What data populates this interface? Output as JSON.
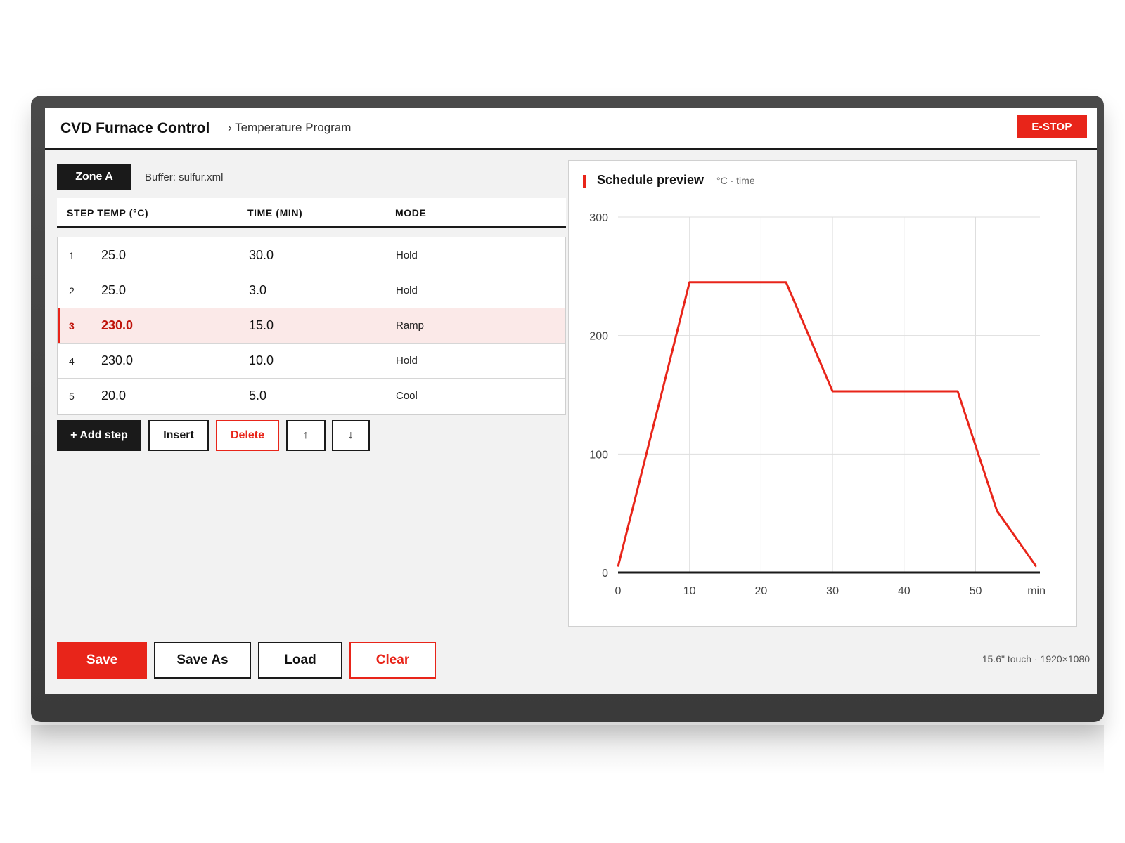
{
  "header": {
    "app_title": "CVD Furnace Control",
    "breadcrumb": "› Temperature Program",
    "estop_label": "E-STOP"
  },
  "program": {
    "zone_label": "Zone A",
    "buffer_label": "Buffer: sulfur.xml",
    "columns": [
      "STEP TEMP (°C)",
      "TIME (MIN)",
      "MODE"
    ],
    "rows": [
      {
        "index": "1",
        "temp": "25.0",
        "time": "30.0",
        "mode": "Hold"
      },
      {
        "index": "2",
        "temp": "25.0",
        "time": "3.0",
        "mode": "Hold"
      },
      {
        "index": "3",
        "temp": "230.0",
        "time": "15.0",
        "mode": "Ramp"
      },
      {
        "index": "4",
        "temp": "230.0",
        "time": "10.0",
        "mode": "Hold"
      },
      {
        "index": "5",
        "temp": "20.0",
        "time": "5.0",
        "mode": "Cool"
      }
    ],
    "selected_row": 3,
    "buttons": {
      "add_step": "+ Add step",
      "insert": "Insert",
      "delete": "Delete",
      "move_up": "↑",
      "move_down": "↓"
    }
  },
  "footer": {
    "save": "Save",
    "save_as": "Save As",
    "load": "Load",
    "clear": "Clear",
    "device_info": "15.6\" touch · 1920×1080"
  },
  "chart_data": {
    "type": "line",
    "title": "Schedule preview",
    "subtitle": "°C · time",
    "xlabel": "min",
    "ylabel": "",
    "xlim": [
      0,
      59
    ],
    "ylim": [
      0,
      300
    ],
    "x_ticks": [
      0,
      10,
      20,
      30,
      40,
      50
    ],
    "y_ticks": [
      0,
      100,
      200,
      300
    ],
    "grid": true,
    "series": [
      {
        "color": "#e8251a",
        "x": [
          0,
          10,
          23.5,
          30,
          47.5,
          53,
          58.5
        ],
        "y": [
          5,
          245,
          245,
          153,
          153,
          52,
          5
        ]
      }
    ]
  },
  "colors": {
    "accent": "#e8251a",
    "dark": "#1a1a1a",
    "selected_row_bg": "#fbe9e8"
  }
}
